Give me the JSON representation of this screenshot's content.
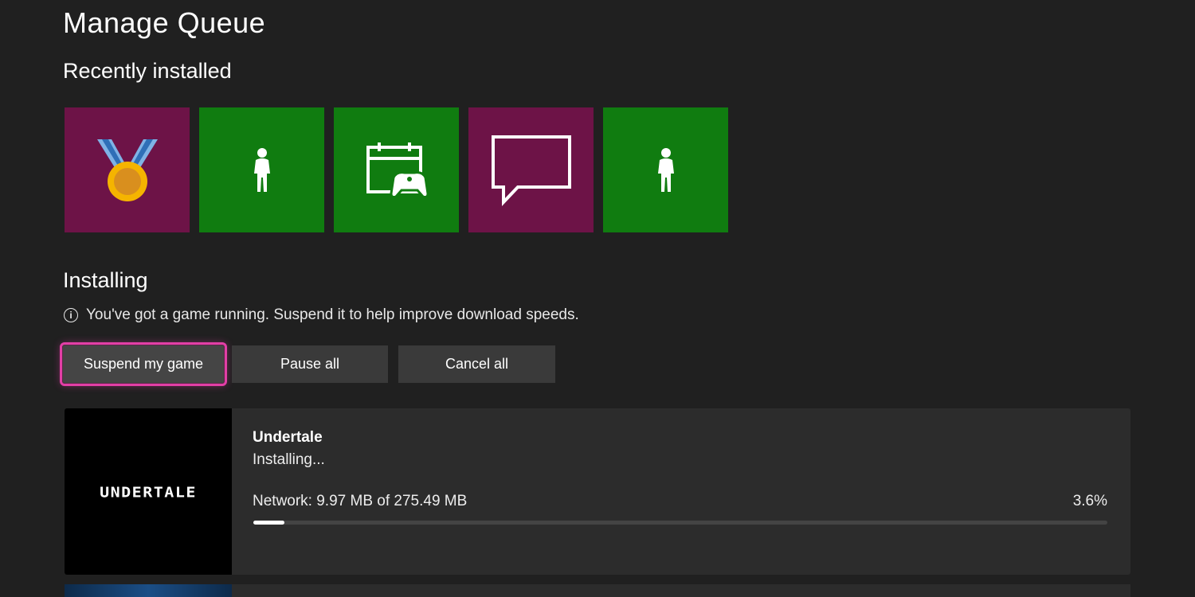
{
  "page": {
    "title": "Manage  Queue"
  },
  "recent": {
    "heading": "Recently installed",
    "tiles": [
      {
        "icon": "medal-icon",
        "color": "#6d1347"
      },
      {
        "icon": "avatar-icon",
        "color": "#107c10"
      },
      {
        "icon": "calendar-controller-icon",
        "color": "#107c10"
      },
      {
        "icon": "chat-bubble-icon",
        "color": "#6d1347"
      },
      {
        "icon": "avatar-icon",
        "color": "#107c10"
      }
    ]
  },
  "installing": {
    "heading": "Installing",
    "notice": "You've got a game running. Suspend it to help improve download speeds.",
    "buttons": {
      "suspend": "Suspend my game",
      "pause": "Pause all",
      "cancel": "Cancel all"
    },
    "items": [
      {
        "title": "Undertale",
        "status": "Installing...",
        "art_text": "UNDERTALE",
        "network": "Network: 9.97 MB of 275.49 MB",
        "percent_label": "3.6%",
        "progress": 0.036
      }
    ]
  },
  "colors": {
    "background": "#202020",
    "focus": "#e23fa6",
    "xbox_green": "#107c10",
    "magenta": "#6d1347"
  }
}
